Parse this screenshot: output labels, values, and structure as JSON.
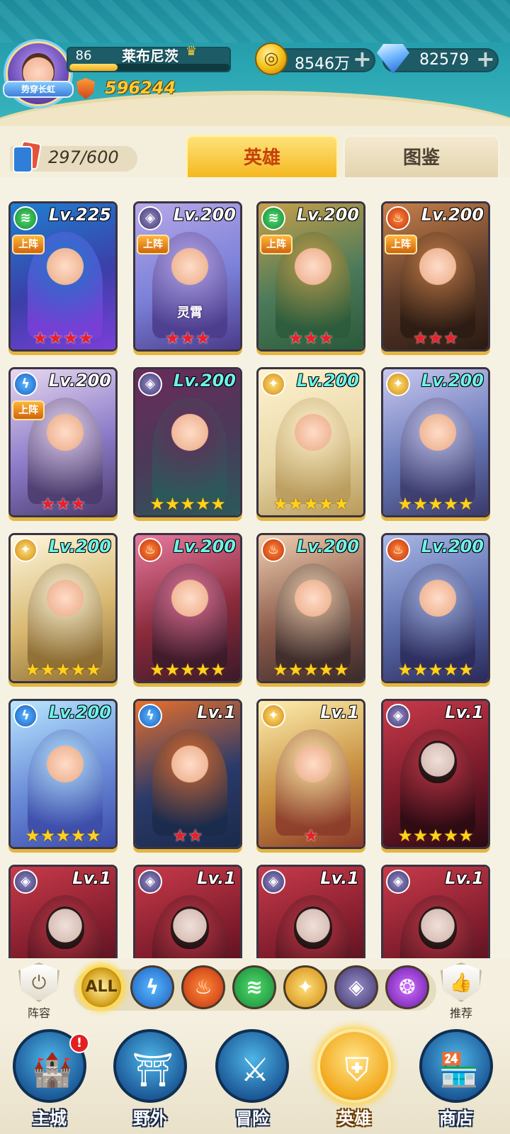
{
  "player": {
    "level": "86",
    "name": "莱布尼茨",
    "avatar_ribbon": "势穿长虹",
    "power": "596244",
    "exp_fraction": 0.3
  },
  "currency": {
    "coins": "8546万",
    "gems": "82579"
  },
  "collection": {
    "count": "297/600"
  },
  "tabs": {
    "heroes": "英雄",
    "book": "图鉴"
  },
  "colors": {
    "tab_active": "#f5b820",
    "level_cyan": "#6ff2e8",
    "star_red": "#e8202a",
    "star_gold": "#ffd21c"
  },
  "heroes": [
    {
      "level": "Lv.225",
      "element": "wind",
      "deployed": "上阵",
      "stars": "★★★★",
      "star_color": "red",
      "lv_color": "white"
    },
    {
      "level": "Lv.200",
      "element": "dark",
      "deployed": "上阵",
      "name": "灵霄",
      "stars": "★★★",
      "star_color": "red",
      "lv_color": "white"
    },
    {
      "level": "Lv.200",
      "element": "wind",
      "deployed": "上阵",
      "stars": "★★★",
      "star_color": "red",
      "lv_color": "white"
    },
    {
      "level": "Lv.200",
      "element": "fire",
      "deployed": "上阵",
      "stars": "★★★",
      "star_color": "red",
      "lv_color": "white"
    },
    {
      "level": "Lv.200",
      "element": "water",
      "deployed": "上阵",
      "stars": "★★★",
      "star_color": "red",
      "lv_color": "white"
    },
    {
      "level": "Lv.200",
      "element": "dark",
      "stars": "★★★★★",
      "star_color": "gold",
      "lv_color": "cyan"
    },
    {
      "level": "Lv.200",
      "element": "light",
      "stars": "★★★★★",
      "star_color": "gold",
      "lv_color": "cyan"
    },
    {
      "level": "Lv.200",
      "element": "light",
      "stars": "★★★★★",
      "star_color": "gold",
      "lv_color": "cyan"
    },
    {
      "level": "Lv.200",
      "element": "light",
      "stars": "★★★★★",
      "star_color": "gold",
      "lv_color": "cyan"
    },
    {
      "level": "Lv.200",
      "element": "fire",
      "stars": "★★★★★",
      "star_color": "gold",
      "lv_color": "cyan"
    },
    {
      "level": "Lv.200",
      "element": "fire",
      "stars": "★★★★★",
      "star_color": "gold",
      "lv_color": "cyan"
    },
    {
      "level": "Lv.200",
      "element": "fire",
      "stars": "★★★★★",
      "star_color": "gold",
      "lv_color": "cyan"
    },
    {
      "level": "Lv.200",
      "element": "water",
      "stars": "★★★★★",
      "star_color": "gold",
      "lv_color": "cyan"
    },
    {
      "level": "Lv.1",
      "element": "water",
      "stars": "★★",
      "star_color": "red",
      "lv_color": "white"
    },
    {
      "level": "Lv.1",
      "element": "light",
      "stars": "★",
      "star_color": "red",
      "lv_color": "white"
    },
    {
      "level": "Lv.1",
      "element": "dark",
      "stars": "★★★★★",
      "star_color": "gold",
      "lv_color": "white"
    },
    {
      "level": "Lv.1",
      "element": "dark",
      "stars": "",
      "star_color": "gold",
      "lv_color": "white"
    },
    {
      "level": "Lv.1",
      "element": "dark",
      "stars": "",
      "star_color": "gold",
      "lv_color": "white"
    },
    {
      "level": "Lv.1",
      "element": "dark",
      "stars": "",
      "star_color": "gold",
      "lv_color": "white"
    },
    {
      "level": "Lv.1",
      "element": "dark",
      "stars": "",
      "star_color": "gold",
      "lv_color": "white"
    }
  ],
  "filter": {
    "lineup_label": "阵容",
    "recommend_label": "推荐",
    "all_label": "ALL",
    "elements": [
      "all",
      "water",
      "fire",
      "wind",
      "light",
      "dark",
      "arcane"
    ]
  },
  "nav": {
    "items": [
      {
        "label": "主城",
        "icon": "castle-icon",
        "badge": "!"
      },
      {
        "label": "野外",
        "icon": "portal-icon"
      },
      {
        "label": "冒险",
        "icon": "sword-icon"
      },
      {
        "label": "英雄",
        "icon": "knight-helmet-icon",
        "active": true
      },
      {
        "label": "商店",
        "icon": "shop-icon"
      }
    ]
  }
}
